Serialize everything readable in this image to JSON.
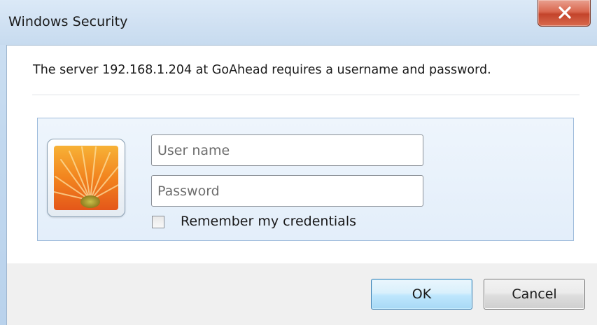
{
  "window": {
    "title": "Windows Security",
    "close_icon": "close-x-icon"
  },
  "dialog": {
    "message": "The server 192.168.1.204 at GoAhead requires a username and password."
  },
  "credentials": {
    "avatar_icon": "user-tile-flower-icon",
    "username": {
      "value": "",
      "placeholder": "User name"
    },
    "password": {
      "value": "",
      "placeholder": "Password"
    },
    "remember": {
      "label": "Remember my credentials",
      "checked": false
    }
  },
  "buttons": {
    "ok_label": "OK",
    "cancel_label": "Cancel"
  },
  "colors": {
    "accent_ok": "#3c7fb1",
    "close_red": "#c3442b",
    "panel_blue": "#e3eefa"
  }
}
